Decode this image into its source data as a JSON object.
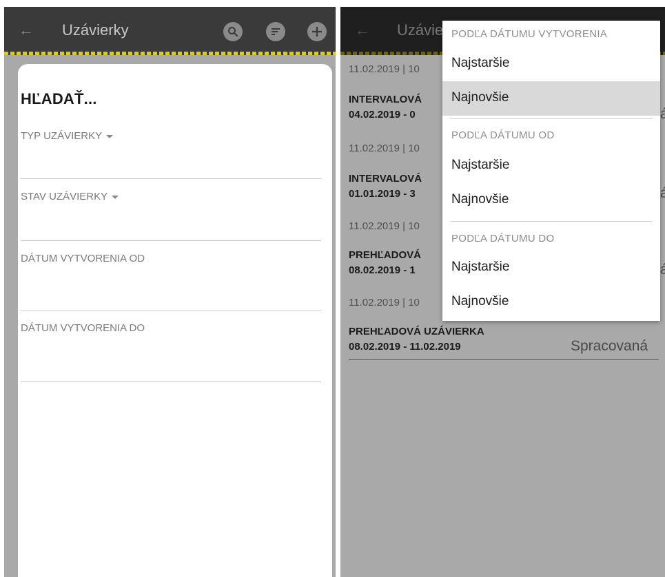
{
  "left": {
    "appbar": {
      "title": "Uzávierky",
      "back_icon": "arrow-left-icon",
      "search_icon": "search-icon",
      "sort_icon": "sort-icon",
      "add_icon": "plus-icon"
    },
    "search_sheet": {
      "title": "HĽADAŤ...",
      "fields": [
        {
          "label": "TYP UZÁVIERKY",
          "dropdown": true
        },
        {
          "label": "STAV UZÁVIERKY",
          "dropdown": true
        },
        {
          "label": "DÁTUM VYTVORENIA OD",
          "dropdown": false
        },
        {
          "label": "DÁTUM VYTVORENIA DO",
          "dropdown": false
        }
      ]
    }
  },
  "right": {
    "appbar": {
      "title": "Uzávie"
    },
    "list": [
      {
        "meta": "11.02.2019 | 10",
        "title": "INTERVALOVÁ",
        "dates": "04.02.2019 - 0",
        "status": "á"
      },
      {
        "meta": "11.02.2019 | 10",
        "title": "INTERVALOVÁ",
        "dates": "01.01.2019 - 3",
        "status": "á"
      },
      {
        "meta": "11.02.2019 | 10",
        "title": "PREHĽADOVÁ",
        "dates": "08.02.2019 - 1",
        "status": "á"
      },
      {
        "meta": "11.02.2019 | 10",
        "title": "PREHĽADOVÁ UZÁVIERKA",
        "dates": "08.02.2019 - 11.02.2019",
        "status": "Spracovaná"
      }
    ],
    "sort_menu": {
      "groups": [
        {
          "header": "PODĽA DÁTUMU VYTVORENIA",
          "items": [
            "Najstaršie",
            "Najnovšie"
          ]
        },
        {
          "header": "PODĽA DÁTUMU OD",
          "items": [
            "Najstaršie",
            "Najnovšie"
          ]
        },
        {
          "header": "PODĽA DÁTUMU DO",
          "items": [
            "Najstaršie",
            "Najnovšie"
          ]
        }
      ],
      "selected": "Najnovšie"
    }
  },
  "colors": {
    "appbar": "#3a3a3a",
    "scrim": "#a9a9a9",
    "accent_stripe": "#d8d000",
    "selected_item": "#d9d9d9"
  }
}
